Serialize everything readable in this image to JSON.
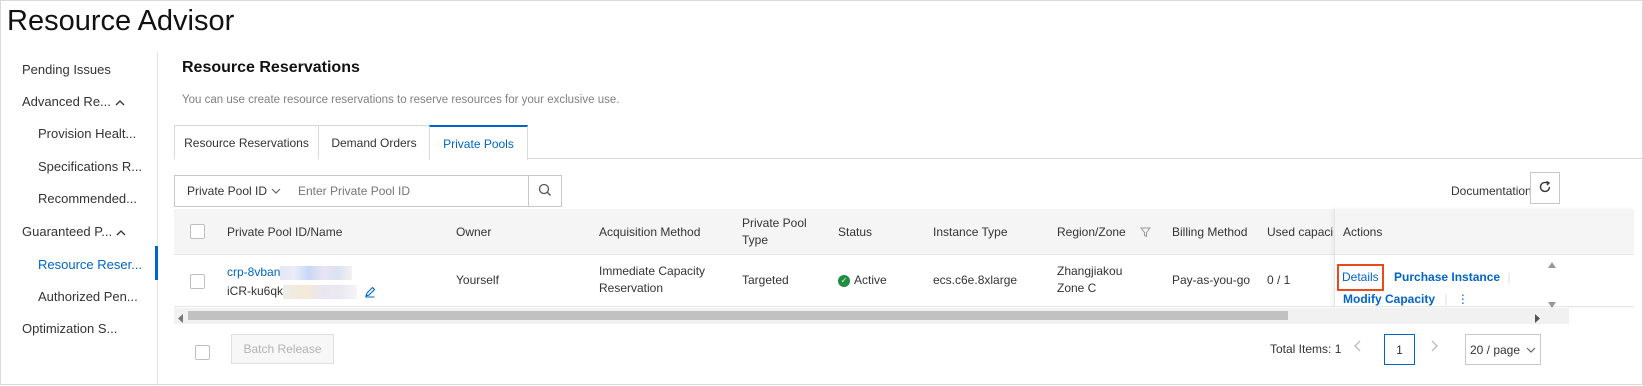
{
  "app": {
    "title": "Resource Advisor"
  },
  "sidebar": {
    "items": [
      {
        "label": "Pending Issues"
      },
      {
        "label": "Advanced Re..."
      },
      {
        "label": "Provision Healt..."
      },
      {
        "label": "Specifications R..."
      },
      {
        "label": "Recommended..."
      },
      {
        "label": "Guaranteed P..."
      },
      {
        "label": "Resource Reser..."
      },
      {
        "label": "Authorized Pen..."
      },
      {
        "label": "Optimization S..."
      }
    ],
    "active_index": 6
  },
  "main": {
    "title": "Resource Reservations",
    "description": "You can use create resource reservations to reserve resources for your exclusive use.",
    "tabs": [
      {
        "label": "Resource Reservations"
      },
      {
        "label": "Demand Orders"
      },
      {
        "label": "Private Pools"
      }
    ],
    "active_tab": 2
  },
  "filter": {
    "field": "Private Pool ID",
    "placeholder": "Enter Private Pool ID",
    "value": ""
  },
  "toolbar": {
    "documentation_label": "Documentation"
  },
  "table": {
    "columns": [
      "Private Pool ID/Name",
      "Owner",
      "Acquisition Method",
      "Private Pool Type",
      "Status",
      "Instance Type",
      "Region/Zone",
      "Billing Method",
      "Used capacit",
      "Actions"
    ],
    "rows": [
      {
        "id": "crp-8vban",
        "name": "iCR-ku6qk",
        "owner": "Yourself",
        "acquisition_method": "Immediate Capacity Reservation",
        "type": "Targeted",
        "status": "Active",
        "instance_type": "ecs.c6e.8xlarge",
        "region_zone": "Zhangjiakou Zone C",
        "billing_method": "Pay-as-you-go",
        "used_capacity": "0 / 1",
        "actions": {
          "details": "Details",
          "purchase": "Purchase Instance",
          "modify": "Modify Capacity",
          "more": "⋮"
        }
      }
    ]
  },
  "footer": {
    "batch_release": "Batch Release",
    "total_items": "Total Items: 1",
    "current_page": "1",
    "page_size": "20 / page"
  },
  "colors": {
    "accent": "#0064c8",
    "highlight_box": "#e8491d",
    "status_active": "#1e8e3e"
  }
}
